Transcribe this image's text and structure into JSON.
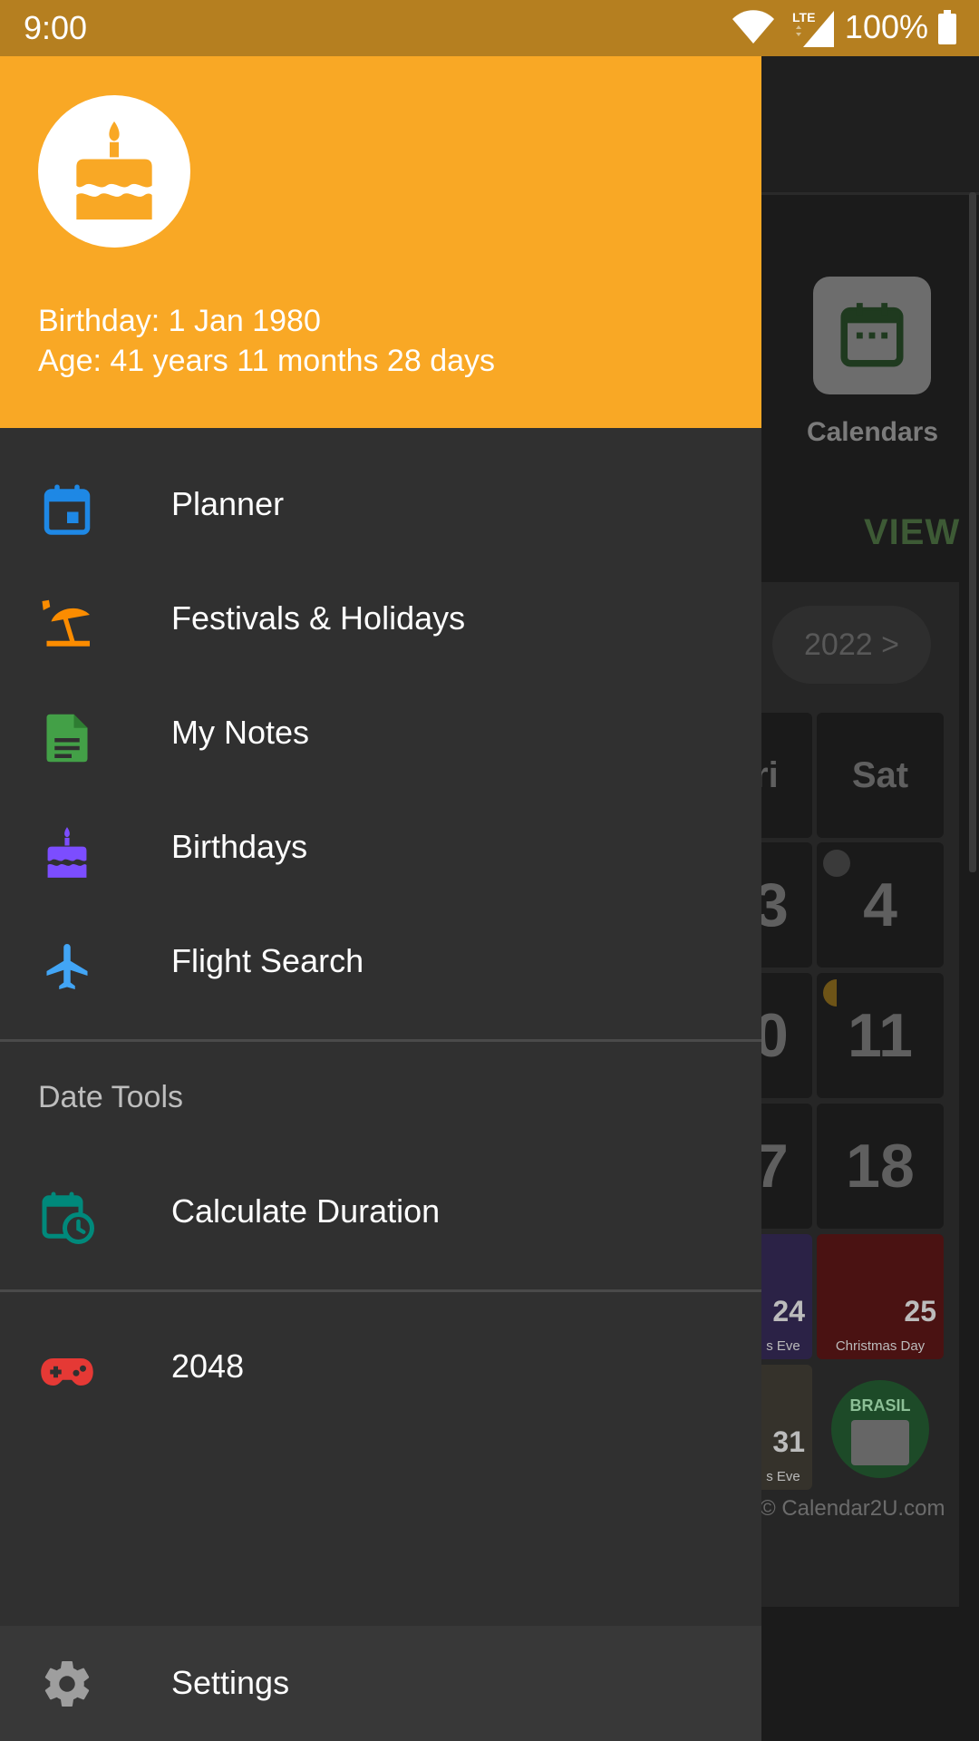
{
  "status_bar": {
    "time": "9:00",
    "network": "LTE",
    "battery": "100%"
  },
  "header": {
    "birthday_line": "Birthday: 1 Jan 1980",
    "age_line": "Age: 41 years 11 months 28 days"
  },
  "menu": [
    {
      "label": "Planner",
      "icon": "calendar-icon",
      "color": "#1e88e5"
    },
    {
      "label": "Festivals & Holidays",
      "icon": "beach-umbrella-icon",
      "color": "#fb8c00"
    },
    {
      "label": "My Notes",
      "icon": "note-icon",
      "color": "#43a047"
    },
    {
      "label": "Birthdays",
      "icon": "cake-icon",
      "color": "#7c4dff"
    },
    {
      "label": "Flight Search",
      "icon": "airplane-icon",
      "color": "#42a5f5"
    }
  ],
  "date_tools": {
    "title": "Date Tools",
    "items": [
      {
        "label": "Calculate Duration",
        "icon": "calendar-clock-icon",
        "color": "#00897b"
      }
    ]
  },
  "games": [
    {
      "label": "2048",
      "icon": "gamepad-icon",
      "color": "#e53935"
    }
  ],
  "settings": {
    "label": "Settings",
    "icon": "gear-icon",
    "color": "#9e9e9e"
  },
  "background": {
    "calendars_label": "Calendars",
    "view_label": "VIEW",
    "year_button": "2022 >",
    "day_headers": [
      "ri",
      "Sat"
    ],
    "dates": [
      "3",
      "4",
      "0",
      "11",
      "7",
      "18"
    ],
    "event_tiles": [
      {
        "day": "24",
        "caption": "s Eve"
      },
      {
        "day": "25",
        "caption": "Christmas Day"
      },
      {
        "day": "31",
        "caption": "s Eve"
      }
    ],
    "brasil_badge": "BRASIL",
    "copyright": "© Calendar2U.com"
  }
}
